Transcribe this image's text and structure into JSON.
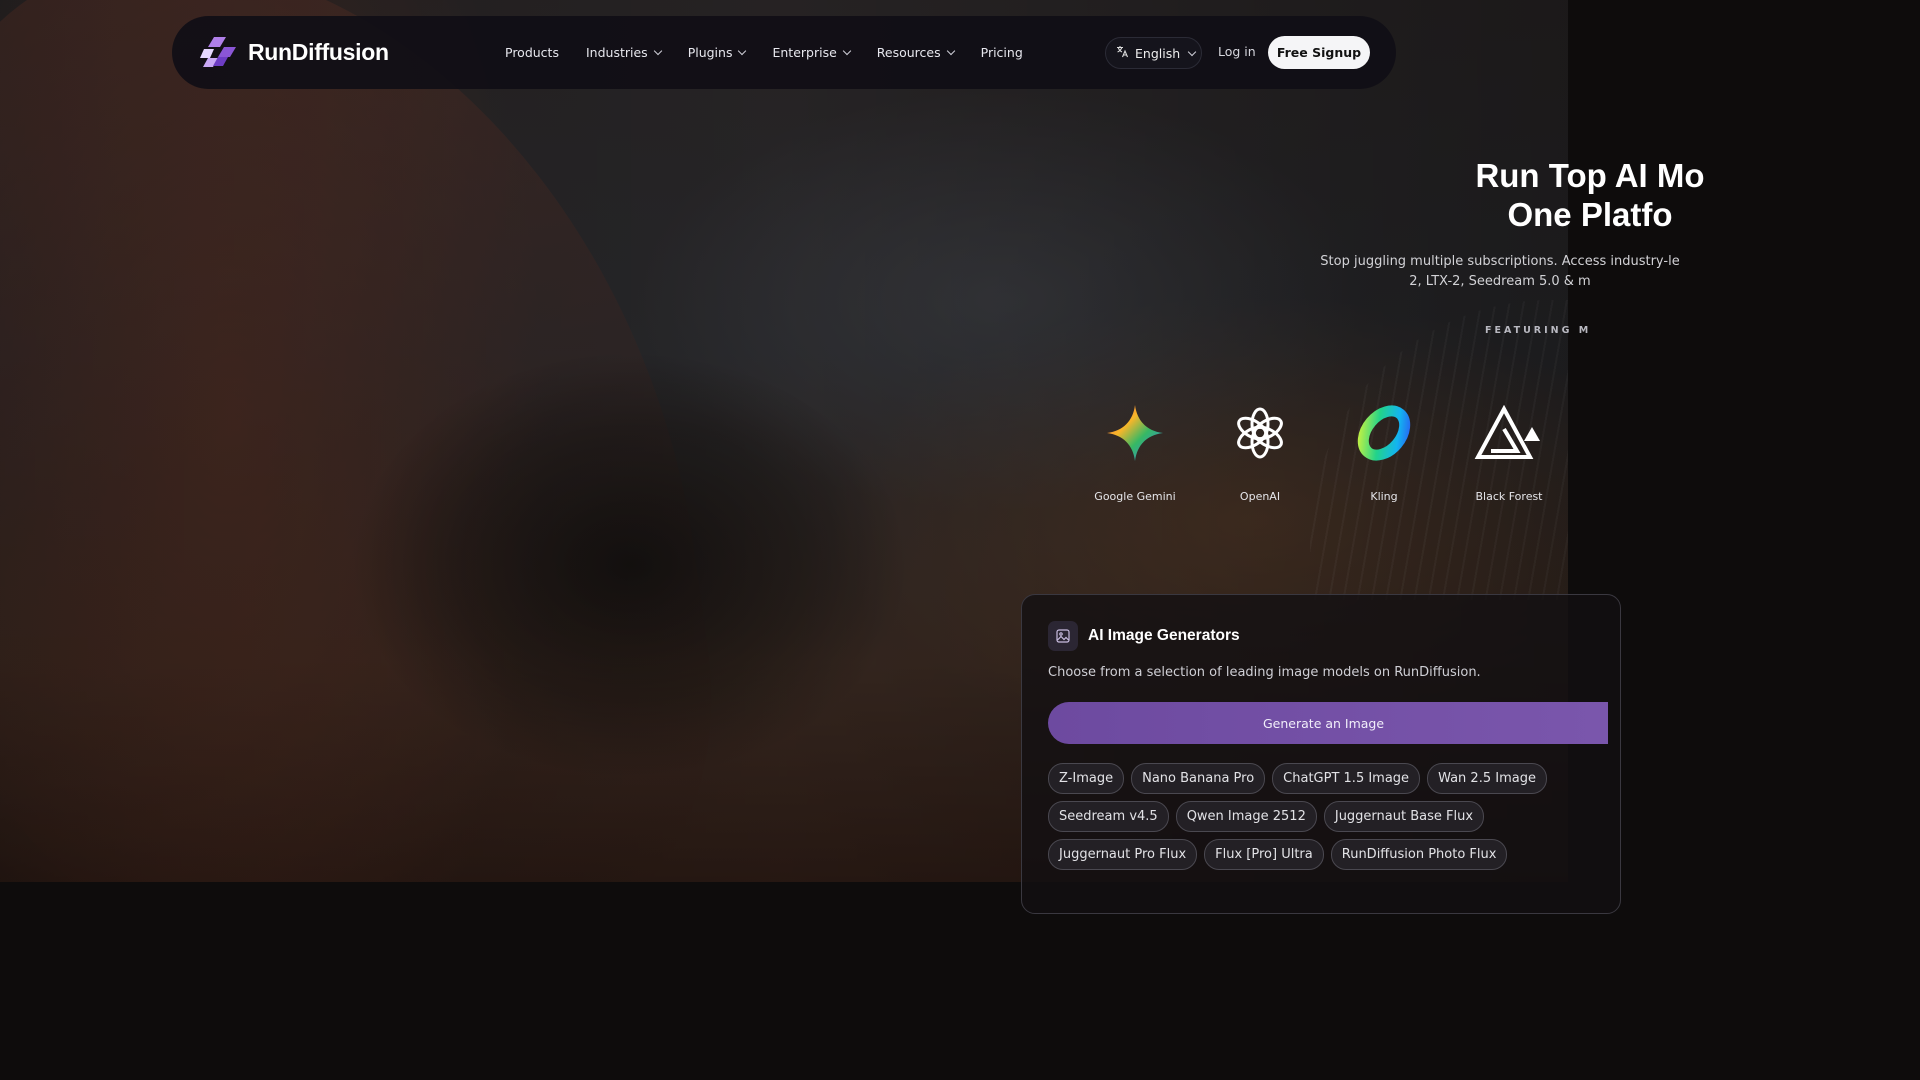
{
  "nav": {
    "logo_text": "RunDiffusion",
    "links": [
      {
        "label": "Products",
        "dropdown": false
      },
      {
        "label": "Industries",
        "dropdown": true
      },
      {
        "label": "Plugins",
        "dropdown": true
      },
      {
        "label": "Enterprise",
        "dropdown": true
      },
      {
        "label": "Resources",
        "dropdown": true
      },
      {
        "label": "Pricing",
        "dropdown": false
      }
    ],
    "language": "English",
    "login": "Log in",
    "signup": "Free Signup"
  },
  "hero": {
    "title_line1": "Run Top AI Mo",
    "title_line2": "One Platfo",
    "sub_line1": "Stop juggling multiple subscriptions. Access industry-le",
    "sub_line2": "2, LTX-2, Seedream 5.0 & m",
    "featuring": "FEATURING M"
  },
  "brands": [
    {
      "name": "Google Gemini",
      "icon": "gemini-icon"
    },
    {
      "name": "OpenAI",
      "icon": "openai-icon"
    },
    {
      "name": "Kling",
      "icon": "kling-icon"
    },
    {
      "name": "Black Forest",
      "icon": "black-forest-icon"
    }
  ],
  "card": {
    "title": "AI Image Generators",
    "icon": "image-icon",
    "description": "Choose from a selection of leading image models on RunDiffusion.",
    "button": "Generate an Image",
    "chips": [
      [
        "Z-Image",
        "Nano Banana Pro",
        "ChatGPT 1.5 Image",
        "Wan 2.5 Image"
      ],
      [
        "Seedream v4.5",
        "Qwen Image 2512",
        "Juggernaut Base Flux"
      ],
      [
        "Juggernaut Pro Flux",
        "Flux [Pro] Ultra",
        "RunDiffusion Photo Flux"
      ]
    ]
  },
  "colors": {
    "accent": "#7a56ac",
    "nav_bg": "#100e16",
    "signup_bg": "#f5f5f7"
  }
}
